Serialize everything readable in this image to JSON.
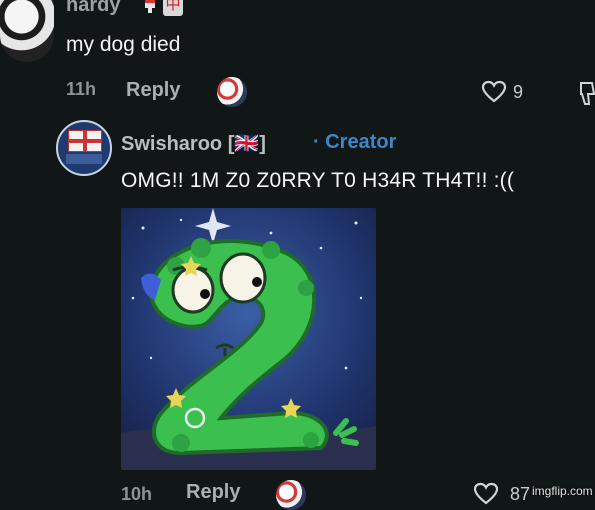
{
  "parent_comment": {
    "username": "hardy",
    "badge": "中",
    "text": "my dog died",
    "time": "11h",
    "reply_label": "Reply",
    "like_count": "9"
  },
  "reply_comment": {
    "username": "Swisharoo [🇬🇧]",
    "creator_label": "· Creator",
    "text": "OMG!! 1M Z0 Z0RRY T0 H34R TH4T!! :((",
    "time": "10h",
    "reply_label": "Reply",
    "like_count": "87"
  },
  "watermark": "imgflip.com",
  "colors": {
    "background": "#111716",
    "creator_blue": "#3c86c9",
    "muted_text": "#8c9494"
  },
  "icons": [
    "heart-icon",
    "dislike-icon",
    "avatar-icon"
  ]
}
